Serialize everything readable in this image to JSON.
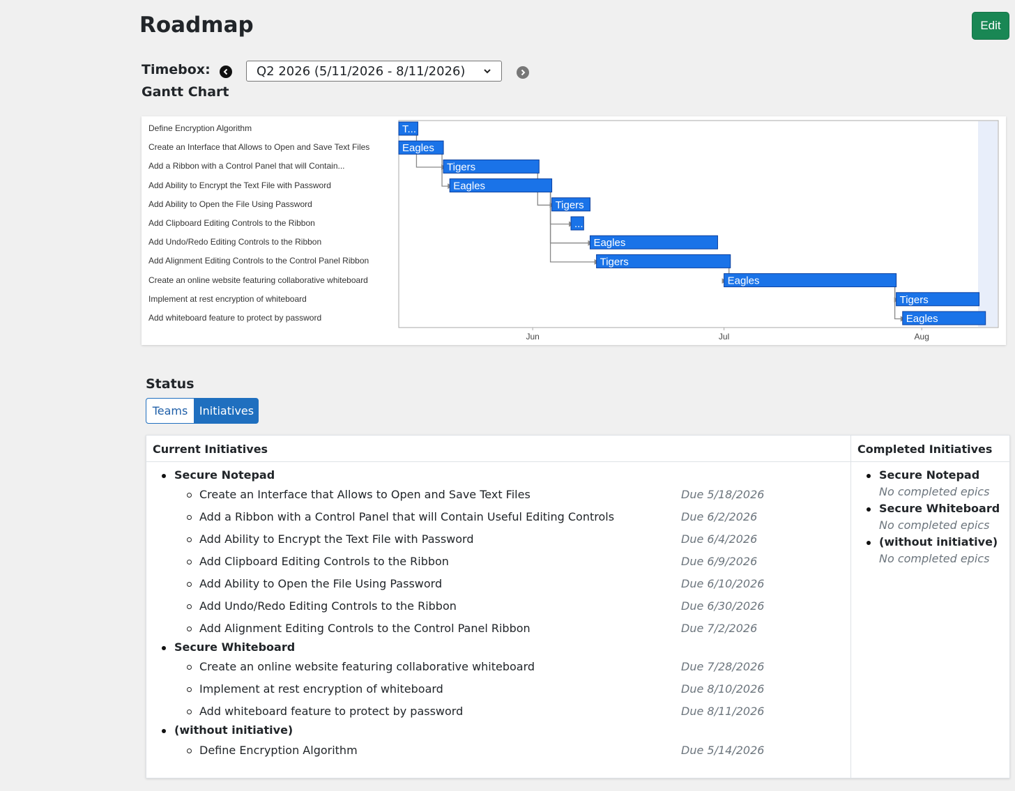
{
  "header": {
    "title": "Roadmap",
    "edit_label": "Edit"
  },
  "timebox": {
    "label": "Timebox:",
    "selected": "Q2 2026 (5/11/2026 - 8/11/2026)",
    "prev_icon": "chevron-left-circle-icon",
    "next_icon": "chevron-right-circle-icon"
  },
  "gantt": {
    "heading": "Gantt Chart",
    "colors": {
      "bar": "#1a73e8",
      "bar_border": "#0b3f9e",
      "arrow": "#888888",
      "today_band": "#e8eefa"
    },
    "tasks": [
      {
        "label": "Define Encryption Algorithm",
        "team": "T...",
        "start": "2026-05-11",
        "end": "2026-05-14"
      },
      {
        "label": "Create an Interface that Allows to Open and Save Text Files",
        "team": "Eagles",
        "start": "2026-05-11",
        "end": "2026-05-18"
      },
      {
        "label": "Add a Ribbon with a Control Panel that will Contain...",
        "team": "Tigers",
        "start": "2026-05-18",
        "end": "2026-06-02"
      },
      {
        "label": "Add Ability to Encrypt the Text File with Password",
        "team": "Eagles",
        "start": "2026-05-19",
        "end": "2026-06-04"
      },
      {
        "label": "Add Ability to Open the File Using Password",
        "team": "Tigers",
        "start": "2026-06-04",
        "end": "2026-06-10"
      },
      {
        "label": "Add Clipboard Editing Controls to the Ribbon",
        "team": "...",
        "start": "2026-06-07",
        "end": "2026-06-09"
      },
      {
        "label": "Add Undo/Redo Editing Controls to the Ribbon",
        "team": "Eagles",
        "start": "2026-06-10",
        "end": "2026-06-30"
      },
      {
        "label": "Add Alignment Editing Controls to the Control Panel Ribbon",
        "team": "Tigers",
        "start": "2026-06-11",
        "end": "2026-07-02"
      },
      {
        "label": "Create an online website featuring collaborative whiteboard",
        "team": "Eagles",
        "start": "2026-07-01",
        "end": "2026-07-28"
      },
      {
        "label": "Implement at rest encryption of whiteboard",
        "team": "Tigers",
        "start": "2026-07-28",
        "end": "2026-08-10"
      },
      {
        "label": "Add whiteboard feature to protect by password",
        "team": "Eagles",
        "start": "2026-07-29",
        "end": "2026-08-11"
      }
    ],
    "axis_ticks": [
      "Jun",
      "Jul",
      "Aug"
    ]
  },
  "status": {
    "heading": "Status",
    "tabs": [
      {
        "label": "Teams",
        "active": false
      },
      {
        "label": "Initiatives",
        "active": true
      }
    ],
    "current_heading": "Current Initiatives",
    "completed_heading": "Completed Initiatives",
    "current": [
      {
        "name": "Secure Notepad",
        "epics": [
          {
            "name": "Create an Interface that Allows to Open and Save Text Files",
            "due": "Due 5/18/2026"
          },
          {
            "name": "Add a Ribbon with a Control Panel that will Contain Useful Editing Controls",
            "due": "Due 6/2/2026"
          },
          {
            "name": "Add Ability to Encrypt the Text File with Password",
            "due": "Due 6/4/2026"
          },
          {
            "name": "Add Clipboard Editing Controls to the Ribbon",
            "due": "Due 6/9/2026"
          },
          {
            "name": "Add Ability to Open the File Using Password",
            "due": "Due 6/10/2026"
          },
          {
            "name": "Add Undo/Redo Editing Controls to the Ribbon",
            "due": "Due 6/30/2026"
          },
          {
            "name": "Add Alignment Editing Controls to the Control Panel Ribbon",
            "due": "Due 7/2/2026"
          }
        ]
      },
      {
        "name": "Secure Whiteboard",
        "epics": [
          {
            "name": "Create an online website featuring collaborative whiteboard",
            "due": "Due 7/28/2026"
          },
          {
            "name": "Implement at rest encryption of whiteboard",
            "due": "Due 8/10/2026"
          },
          {
            "name": "Add whiteboard feature to protect by password",
            "due": "Due 8/11/2026"
          }
        ]
      },
      {
        "name": "(without initiative)",
        "epics": [
          {
            "name": "Define Encryption Algorithm",
            "due": "Due 5/14/2026"
          }
        ]
      }
    ],
    "completed": [
      {
        "name": "Secure Notepad",
        "note": "No completed epics"
      },
      {
        "name": "Secure Whiteboard",
        "note": "No completed epics"
      },
      {
        "name": "(without initiative)",
        "note": "No completed epics"
      }
    ]
  }
}
